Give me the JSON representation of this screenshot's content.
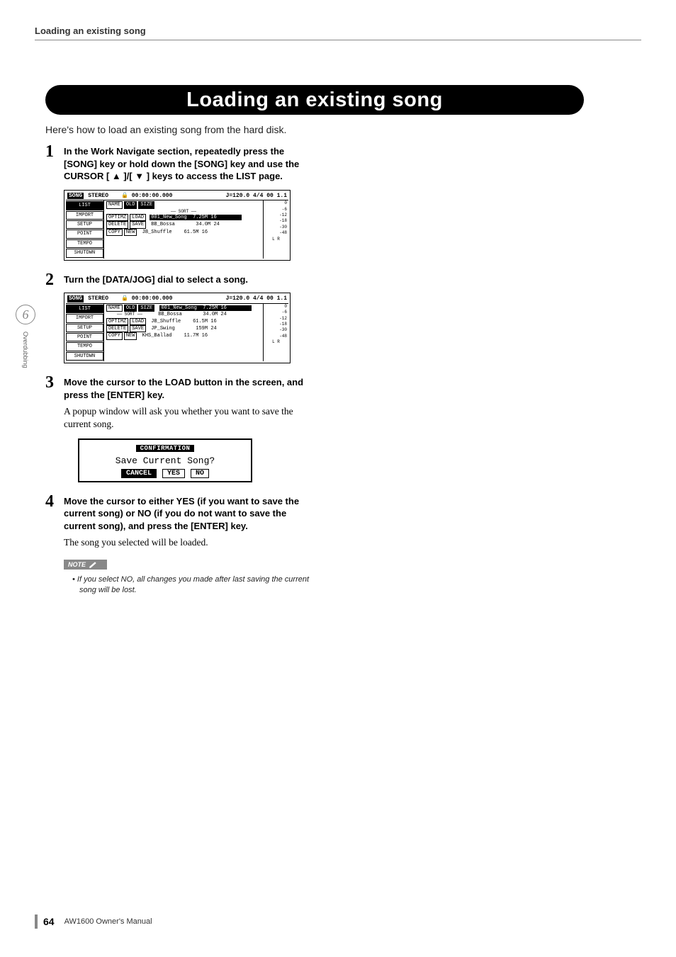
{
  "header": {
    "running": "Loading an existing song"
  },
  "title": "Loading an existing song",
  "intro": "Here's how to load an existing song from the hard disk.",
  "steps": [
    {
      "num": "1",
      "body": "In the Work Navigate section, repeatedly press the [SONG] key or hold down the [SONG] key and use the CURSOR [ ▲ ]/[ ▼ ] keys to access the LIST page."
    },
    {
      "num": "2",
      "body": "Turn the [DATA/JOG] dial to select a song."
    },
    {
      "num": "3",
      "body": "Move the cursor to the LOAD button in the screen, and press the [ENTER] key.",
      "follow": "A popup window will ask you whether you want to save the current song."
    },
    {
      "num": "4",
      "body": "Move the cursor to either YES (if you want to save the current song) or NO (if you do not want to save the current song), and press the [ENTER] key.",
      "follow": "The song you selected will be loaded."
    }
  ],
  "shot1": {
    "headerTitle": "SONG",
    "stereo": "STEREO",
    "time": "00:00:00.000",
    "tempo": "J=120.0 4/4 00 1.1",
    "tabs": [
      "LIST",
      "IMPORT",
      "SETUP",
      "POINT",
      "TEMPO",
      "SHUTDWN"
    ],
    "sort": "SORT",
    "sortBtns": [
      "NAME",
      "OLD",
      "SIZE"
    ],
    "midBtns": [
      [
        "OPTIMZ",
        "LOAD"
      ],
      [
        "DELETE",
        "SAVE"
      ],
      [
        "COPY",
        "NEW"
      ]
    ],
    "rows": [
      {
        "name": "001_New_Song",
        "size": "7.25M 16",
        "sel": true
      },
      {
        "name": "BB_Bossa",
        "size": "34.0M 24",
        "sel": false
      },
      {
        "name": "JB_Shuffle",
        "size": "61.5M 16",
        "sel": false
      }
    ],
    "meter": [
      "0",
      "-6",
      "-12",
      "-18",
      "-30",
      "-48"
    ],
    "lr": "L R"
  },
  "shot2": {
    "headerTitle": "SONG",
    "stereo": "STEREO",
    "time": "00:00:00.000",
    "tempo": "J=120.0 4/4 00 1.1",
    "tabs": [
      "LIST",
      "IMPORT",
      "SETUP",
      "POINT",
      "TEMPO",
      "SHUTDWN"
    ],
    "sort": "SORT",
    "sortBtns": [
      "NAME",
      "OLD",
      "SIZE"
    ],
    "midBtns": [
      [
        "OPTIMZ",
        "LOAD"
      ],
      [
        "DELETE",
        "SAVE"
      ],
      [
        "COPY",
        "NEW"
      ]
    ],
    "rows": [
      {
        "name": "001_New_Song",
        "size": "7.25M 16",
        "sel": true
      },
      {
        "name": "BB_Bossa",
        "size": "34.0M 24",
        "sel": false
      },
      {
        "name": "JB_Shuffle",
        "size": "61.5M 16",
        "sel": false
      },
      {
        "name": "JP_Swing",
        "size": "159M 24",
        "sel": false
      },
      {
        "name": "KHS_Ballad",
        "size": "11.7M 16",
        "sel": false
      }
    ],
    "meter": [
      "0",
      "-6",
      "-12",
      "-18",
      "-30",
      "-48"
    ],
    "lr": "L R"
  },
  "confirm": {
    "title": "CONFIRMATION",
    "msg": "Save Current Song?",
    "btns": [
      "CANCEL",
      "YES",
      "NO"
    ]
  },
  "note": {
    "label": "NOTE",
    "text": "If you select NO, all changes you made after last saving the current song will be lost."
  },
  "side": {
    "chapter": "6",
    "name": "Overdubbing"
  },
  "footer": {
    "page": "64",
    "manual": "AW1600  Owner's Manual"
  }
}
